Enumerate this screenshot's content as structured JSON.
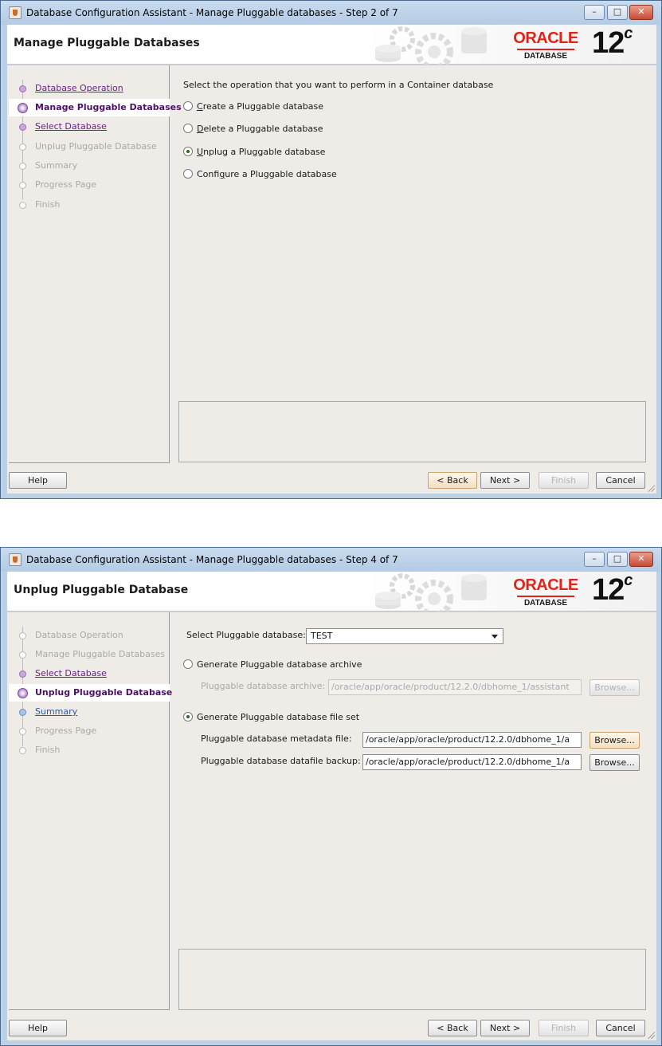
{
  "window1": {
    "title": "Database Configuration Assistant - Manage Pluggable databases - Step 2 of 7",
    "page_title": "Manage Pluggable Databases",
    "nav": [
      {
        "label": "Database Operation",
        "state": "done"
      },
      {
        "label": "Manage Pluggable Databases",
        "state": "current"
      },
      {
        "label": "Select Database",
        "state": "next"
      },
      {
        "label": "Unplug Pluggable Database",
        "state": "disabled"
      },
      {
        "label": "Summary",
        "state": "disabled"
      },
      {
        "label": "Progress Page",
        "state": "disabled"
      },
      {
        "label": "Finish",
        "state": "disabled"
      }
    ],
    "prompt": "Select the operation that you want to perform in a Container database",
    "options": [
      {
        "mnemonic": "C",
        "rest": "reate a Pluggable database",
        "selected": false
      },
      {
        "mnemonic": "D",
        "rest": "elete a Pluggable database",
        "selected": false
      },
      {
        "mnemonic": "U",
        "rest": "nplug a Pluggable database",
        "selected": true
      },
      {
        "pre": "Confi",
        "mnemonic": "g",
        "rest": "ure a Pluggable database",
        "selected": false
      }
    ],
    "buttons": {
      "help": "Help",
      "back": "< Back",
      "next": "Next >",
      "finish": "Finish",
      "cancel": "Cancel"
    }
  },
  "window2": {
    "title": "Database Configuration Assistant - Manage Pluggable databases - Step 4 of 7",
    "page_title": "Unplug Pluggable Database",
    "nav": [
      {
        "label": "Database Operation",
        "state": "disabled"
      },
      {
        "label": "Manage Pluggable Databases",
        "state": "disabled"
      },
      {
        "label": "Select Database",
        "state": "done"
      },
      {
        "label": "Unplug Pluggable Database",
        "state": "current"
      },
      {
        "label": "Summary",
        "state": "next"
      },
      {
        "label": "Progress Page",
        "state": "disabled"
      },
      {
        "label": "Finish",
        "state": "disabled"
      }
    ],
    "select_pdb_label": "Select Pluggable database:",
    "select_pdb_value": "TEST",
    "opt_archive": "Generate Pluggable database archive",
    "archive_label": "Pluggable database archive:",
    "archive_value": "/oracle/app/oracle/product/12.2.0/dbhome_1/assistant",
    "opt_fileset": "Generate Pluggable database file set",
    "metadata_label": "Pluggable database metadata file:",
    "metadata_value": "/oracle/app/oracle/product/12.2.0/dbhome_1/a",
    "datafile_label": "Pluggable database datafile backup:",
    "datafile_value": "/oracle/app/oracle/product/12.2.0/dbhome_1/a",
    "browse": "Browse...",
    "buttons": {
      "help": "Help",
      "back": "< Back",
      "next": "Next >",
      "finish": "Finish",
      "cancel": "Cancel"
    }
  },
  "branding": {
    "oracle": "ORACLE",
    "sub": "DATABASE",
    "version": "12",
    "version_suffix": "c"
  },
  "colors": {
    "oracle_red": "#e2231a",
    "nav_done": "#6a2380",
    "nav_next": "#2c5aa0"
  }
}
